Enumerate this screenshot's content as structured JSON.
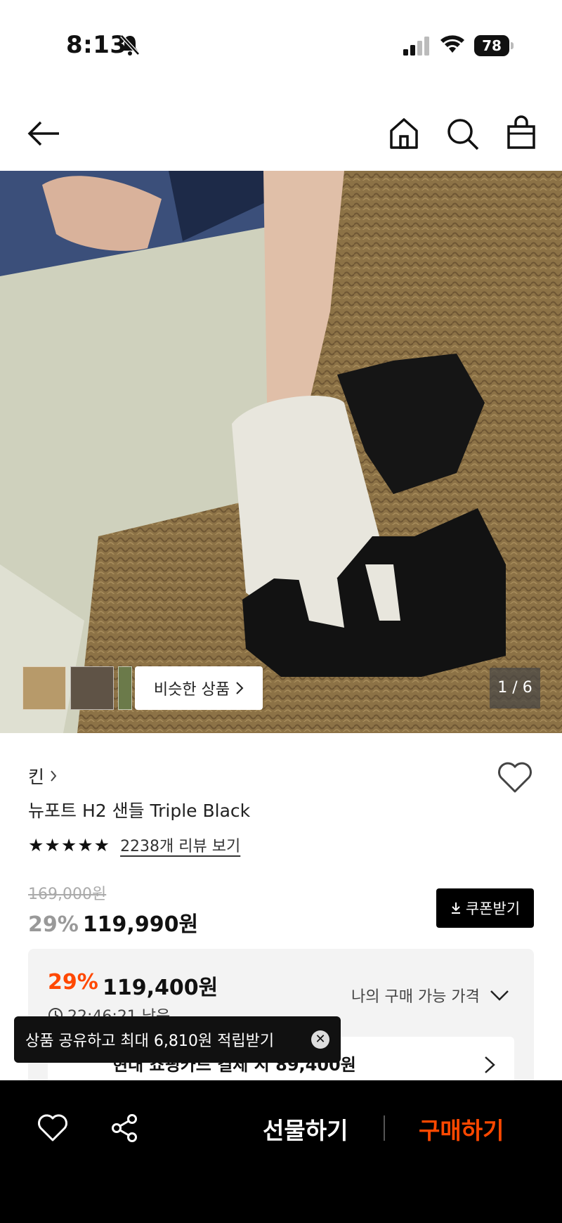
{
  "status_bar": {
    "time": "8:13",
    "battery": "78",
    "icons": [
      "bell-slash-icon",
      "signal-icon",
      "wifi-icon",
      "battery-icon"
    ]
  },
  "nav": {
    "icons": [
      "back-arrow-icon",
      "home-icon",
      "search-icon",
      "shopping-bag-icon"
    ]
  },
  "gallery": {
    "similar_label": "비슷한 상품",
    "counter": "1 / 6"
  },
  "product": {
    "brand": "킨",
    "title": "뉴포트 H2 샌들 Triple Black",
    "rating_stars": "★★★★★",
    "rating_value": 5,
    "review_link": "2238개 리뷰 보기",
    "original_price": "169,000원",
    "discount": "29%",
    "price": "119,990원",
    "coupon_label": "쿠폰받기"
  },
  "price_box": {
    "discount": "29%",
    "price": "119,400원",
    "timer": "22:46:21 남음",
    "my_price_label": "나의 구매 가능 가격",
    "card_text": "현대 쇼핑카드 결제 시 89,400원"
  },
  "toast": {
    "text": "상품 공유하고 최대 6,810원 적립받기",
    "close": "✕"
  },
  "bottom_bar": {
    "gift_label": "선물하기",
    "buy_label": "구매하기"
  },
  "colors": {
    "accent": "#ff4800",
    "dark": "#000000"
  }
}
